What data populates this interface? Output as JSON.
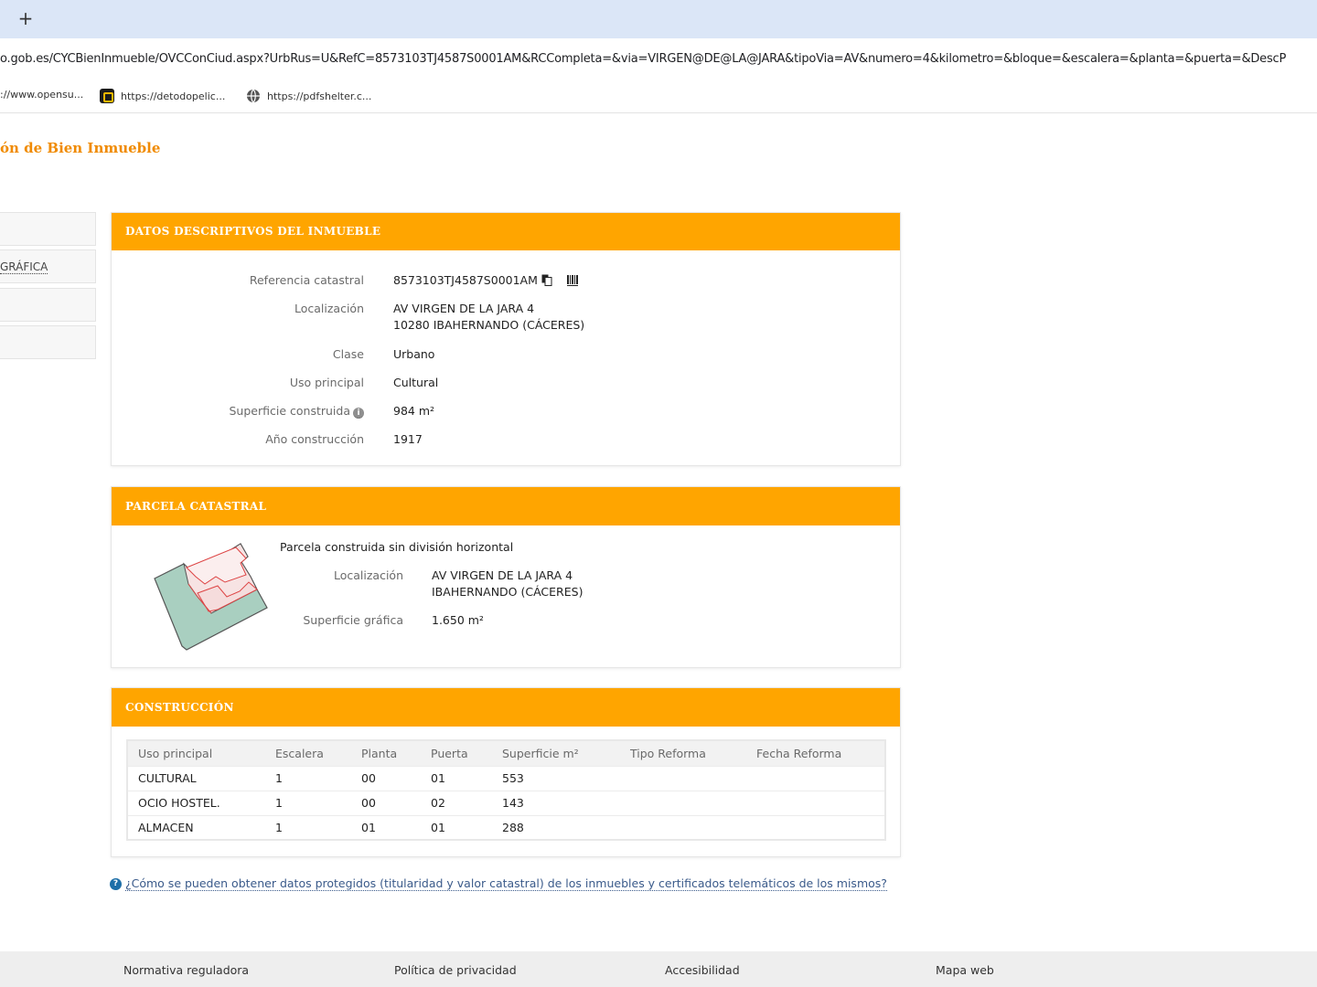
{
  "browser": {
    "new_tab": "+",
    "url": "o.gob.es/CYCBienInmueble/OVCConCiud.aspx?UrbRus=U&RefC=8573103TJ4587S0001AM&RCCompleta=&via=VIRGEN@DE@LA@JARA&tipoVia=AV&numero=4&kilometro=&bloque=&escalera=&planta=&puerta=&DescP",
    "bookmarks": [
      {
        "label": "://www.opensu...",
        "icon": "none"
      },
      {
        "label": "https://detodopelic...",
        "icon": "site-icon"
      },
      {
        "label": "https://pdfshelter.c...",
        "icon": "globe-icon"
      }
    ]
  },
  "page": {
    "title": "ón de Bien Inmueble"
  },
  "left_menu": {
    "items": [
      {
        "label": ""
      },
      {
        "label": "GRÁFICA"
      },
      {
        "label": ""
      },
      {
        "label": ""
      }
    ]
  },
  "descriptive": {
    "header": "DATOS DESCRIPTIVOS DEL INMUEBLE",
    "ref_label": "Referencia catastral",
    "ref_value": "8573103TJ4587S0001AM",
    "loc_label": "Localización",
    "loc_line1": "AV VIRGEN DE LA JARA 4",
    "loc_line2": "10280 IBAHERNANDO (CÁCERES)",
    "clase_label": "Clase",
    "clase_value": "Urbano",
    "uso_label": "Uso principal",
    "uso_value": "Cultural",
    "sup_label": "Superficie construida",
    "sup_value": "984 m²",
    "anio_label": "Año construcción",
    "anio_value": "1917"
  },
  "parcela": {
    "header": "PARCELA CATASTRAL",
    "subtitle": "Parcela construida sin división horizontal",
    "loc_label": "Localización",
    "loc_line1": "AV VIRGEN DE LA JARA 4",
    "loc_line2": "IBAHERNANDO (CÁCERES)",
    "sup_label": "Superficie gráfica",
    "sup_value": "1.650 m²"
  },
  "construccion": {
    "header": "CONSTRUCCIÓN",
    "columns": [
      "Uso principal",
      "Escalera",
      "Planta",
      "Puerta",
      "Superficie m²",
      "Tipo Reforma",
      "Fecha Reforma"
    ],
    "rows": [
      [
        "CULTURAL",
        "1",
        "00",
        "01",
        "553",
        "",
        ""
      ],
      [
        "OCIO HOSTEL.",
        "1",
        "00",
        "02",
        "143",
        "",
        ""
      ],
      [
        "ALMACEN",
        "1",
        "01",
        "01",
        "288",
        "",
        ""
      ]
    ]
  },
  "question_link": "¿Cómo se pueden obtener datos protegidos (titularidad y valor catastral) de los inmuebles y certificados telemáticos de los mismos?",
  "footer": {
    "links": [
      "Normativa reguladora",
      "Política de privacidad",
      "Accesibilidad",
      "Mapa web"
    ]
  }
}
